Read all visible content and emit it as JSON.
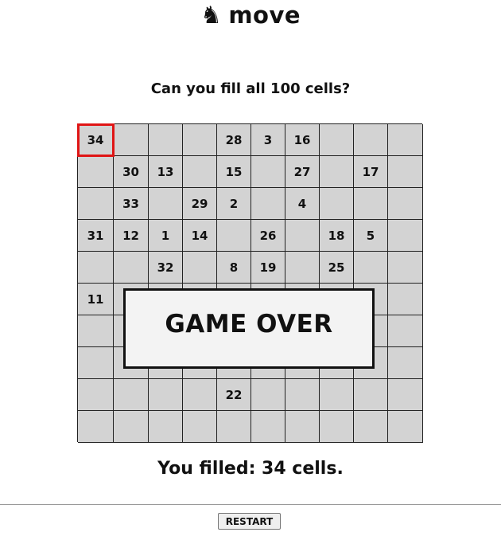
{
  "header": {
    "icon": "chess-knight-icon",
    "glyph": "♞",
    "title": "move"
  },
  "prompt": "Can you fill all 100 cells?",
  "board": {
    "size": 10,
    "current_cell": {
      "row": 0,
      "col": 0
    },
    "current_color": "#e01515",
    "cell_color": "#d3d3d3",
    "cells": [
      [
        "34",
        "",
        "",
        "",
        "28",
        "3",
        "16",
        "",
        "",
        ""
      ],
      [
        "",
        "30",
        "13",
        "",
        "15",
        "",
        "27",
        "",
        "17",
        ""
      ],
      [
        "",
        "33",
        "",
        "29",
        "2",
        "",
        "4",
        "",
        "",
        ""
      ],
      [
        "31",
        "12",
        "1",
        "14",
        "",
        "26",
        "",
        "18",
        "5",
        ""
      ],
      [
        "",
        "",
        "32",
        "",
        "8",
        "19",
        "",
        "25",
        "",
        ""
      ],
      [
        "11",
        "",
        "",
        "",
        "",
        "",
        "",
        "",
        "",
        ""
      ],
      [
        "",
        "",
        "",
        "",
        "",
        "",
        "",
        "",
        "",
        ""
      ],
      [
        "",
        "",
        "",
        "",
        "",
        "",
        "",
        "",
        "",
        ""
      ],
      [
        "",
        "",
        "",
        "",
        "22",
        "",
        "",
        "",
        "",
        ""
      ],
      [
        "",
        "",
        "",
        "",
        "",
        "",
        "",
        "",
        "",
        ""
      ]
    ]
  },
  "overlay": {
    "text": "GAME OVER"
  },
  "result": "You filled: 34 cells.",
  "restart_label": "RESTART"
}
